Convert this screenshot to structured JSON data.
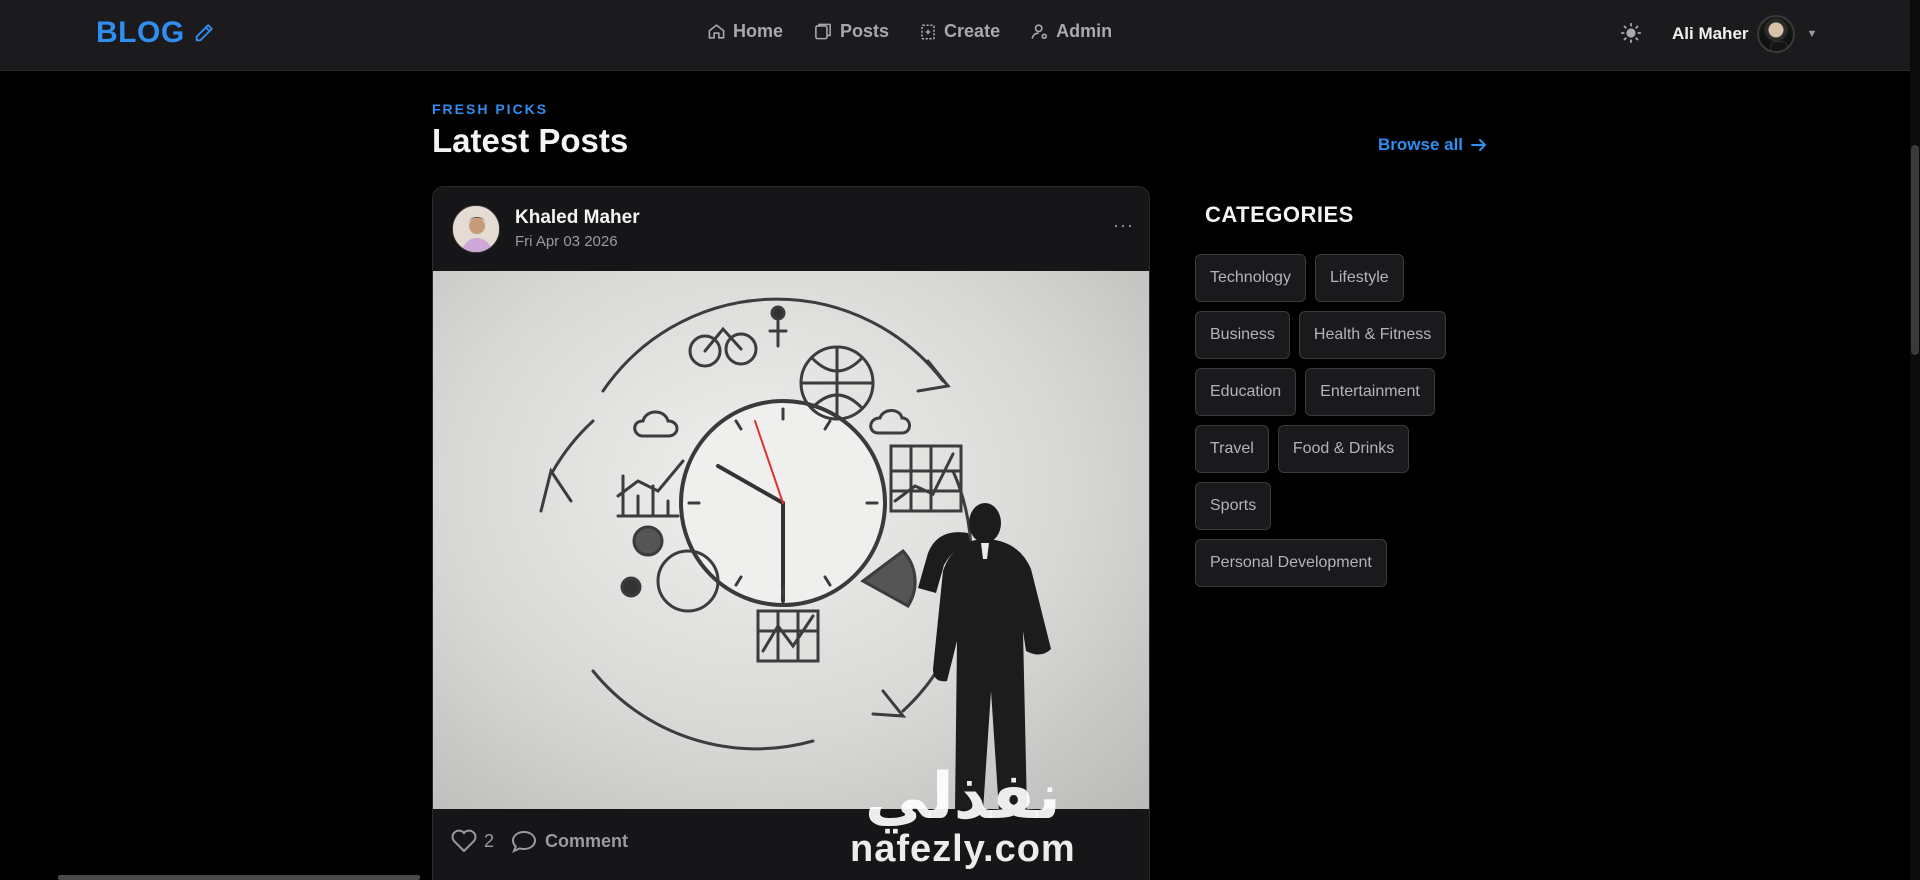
{
  "navbar": {
    "brand": "BLOG",
    "links": [
      {
        "label": "Home",
        "icon": "home-icon"
      },
      {
        "label": "Posts",
        "icon": "posts-icon"
      },
      {
        "label": "Create",
        "icon": "create-icon"
      },
      {
        "label": "Admin",
        "icon": "admin-icon"
      }
    ],
    "user_name": "Ali Maher"
  },
  "header": {
    "kicker": "FRESH PICKS",
    "title": "Latest Posts",
    "browse_all": "Browse all"
  },
  "post": {
    "author": "Khaled Maher",
    "date": "Fri Apr 03 2026",
    "likes": "2",
    "comment_label": "Comment"
  },
  "categories": {
    "title": "CATEGORIES",
    "rows": [
      [
        "Technology",
        "Lifestyle"
      ],
      [
        "Business",
        "Health & Fitness"
      ],
      [
        "Education",
        "Entertainment"
      ],
      [
        "Travel",
        "Food & Drinks"
      ],
      [
        "Sports"
      ],
      [
        "Personal Development"
      ]
    ]
  },
  "watermark": {
    "arabic": "نفذلي",
    "latin": "nafezly.com"
  },
  "colors": {
    "accent": "#2f8ef0",
    "background": "#000000",
    "navbar": "#1b1b1d",
    "card": "#161618"
  }
}
